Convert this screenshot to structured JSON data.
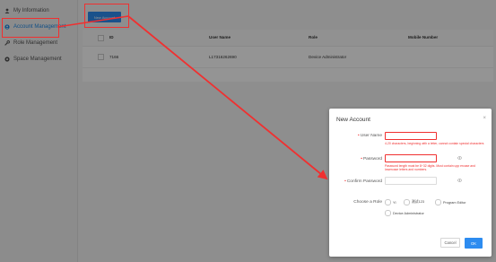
{
  "sidebar": {
    "items": [
      {
        "label": "My Information",
        "icon": "user-icon"
      },
      {
        "label": "Account Management",
        "icon": "account-icon"
      },
      {
        "label": "Role Management",
        "icon": "wrench-icon"
      },
      {
        "label": "Space Management",
        "icon": "space-icon"
      }
    ],
    "active_color": "#1e88e5"
  },
  "toolbar": {
    "new_account_label": "New Account"
  },
  "table": {
    "columns": [
      "ID",
      "User Name",
      "Role",
      "Mobile Number"
    ],
    "rows": [
      {
        "id": "7166",
        "user_name": "L17316262690",
        "role": "Device Administrator",
        "mobile": ""
      }
    ]
  },
  "modal": {
    "title": "New Account",
    "close_symbol": "×",
    "user_name": {
      "label": "User Name",
      "value": "",
      "placeholder": "",
      "hint": "4-20 characters, beginning with a letter, cannot contain special characters"
    },
    "password": {
      "label": "Password",
      "value": "",
      "placeholder": "",
      "hint": "Password length must be 8~32 digits. Must contain upp ercase and lowercase letters and numbers."
    },
    "confirm_password": {
      "label": "Confirm Password",
      "value": "",
      "placeholder": ""
    },
    "role": {
      "label": "Choose a Role",
      "options": [
        "YI",
        "测试123",
        "Program Editor",
        "Device Administrator"
      ]
    },
    "cancel_label": "Cancel",
    "ok_label": "OK"
  },
  "colors": {
    "primary": "#2d8cf0",
    "annotation_red": "#f03030",
    "error": "#f03030"
  }
}
